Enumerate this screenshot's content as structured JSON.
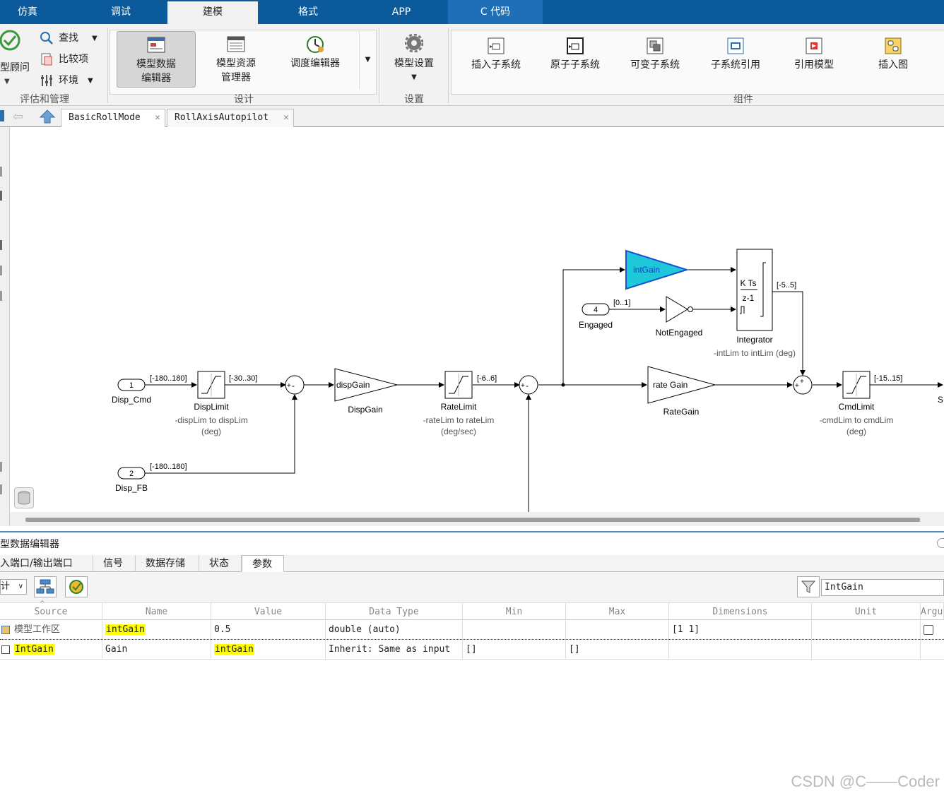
{
  "top_tabs": [
    {
      "label": "仿真"
    },
    {
      "label": "调试"
    },
    {
      "label": "建模"
    },
    {
      "label": "格式"
    },
    {
      "label": "APP"
    },
    {
      "label": "C 代码"
    }
  ],
  "ribbon": {
    "eval_section": {
      "advisor": "型顾问",
      "find": "查找",
      "compare": "比较项",
      "env": "环境",
      "label": "评估和管理"
    },
    "design_section": {
      "mde_line1": "模型数据",
      "mde_line2": "编辑器",
      "res_line1": "模型资源",
      "res_line2": "管理器",
      "schedule": "调度编辑器",
      "label": "设计"
    },
    "setup_section": {
      "model_settings": "模型设置",
      "label": "设置"
    },
    "component_section": {
      "items": [
        {
          "label": "插入子系统"
        },
        {
          "label": "原子子系统"
        },
        {
          "label": "可变子系统"
        },
        {
          "label": "子系统引用"
        },
        {
          "label": "引用模型"
        },
        {
          "label": "插入图"
        }
      ],
      "label": "组件"
    }
  },
  "breadcrumb_tabs": [
    {
      "label": "BasicRollMode"
    },
    {
      "label": "RollAxisAutopilot"
    }
  ],
  "diagram": {
    "inport1_num": "1",
    "inport1_name": "Disp_Cmd",
    "sig1": "[-180..180]",
    "displimit_name": "DispLimit",
    "displimit_sub1": "-dispLim to dispLim",
    "displimit_sub2": "(deg)",
    "sig2": "[-30..30]",
    "sum1_sign1": "+",
    "sum1_sign2": "-",
    "dispgain_param": "dispGain",
    "dispgain_name": "DispGain",
    "ratelimit_name": "RateLimit",
    "ratelimit_sub1": "-rateLim to rateLim",
    "ratelimit_sub2": "(deg/sec)",
    "sig3": "[-6..6]",
    "sum2_sign1": "+",
    "sum2_sign2": "-",
    "inport2_num": "2",
    "inport2_name": "Disp_FB",
    "sig4": "[-180..180]",
    "intgain_param": "intGain",
    "inport4_num": "4",
    "inport4_name": "Engaged",
    "sig5": "[0..1]",
    "not_name": "NotEngaged",
    "integrator_num": "K Ts",
    "integrator_den": "z-1",
    "integrator_name": "Integrator",
    "integrator_sub": "-intLim to intLim (deg)",
    "sig6": "[-5..5]",
    "rategain_param": "rate Gain",
    "rategain_name": "RateGain",
    "sum3_sign1": "+",
    "sum3_sign2": "+",
    "cmdlimit_name": "CmdLimit",
    "cmdlimit_sub1": "-cmdLim to cmdLim",
    "cmdlimit_sub2": "(deg)",
    "sig7": "[-15..15]",
    "out_partial": "S"
  },
  "mde": {
    "title": "型数据编辑器",
    "tabs": [
      {
        "label": "入端口/输出端口"
      },
      {
        "label": "信号"
      },
      {
        "label": "数据存储"
      },
      {
        "label": "状态"
      },
      {
        "label": "参数"
      }
    ],
    "filter_value": "计",
    "search_value": "IntGain",
    "columns": [
      "Source",
      "Name",
      "Value",
      "Data Type",
      "Min",
      "Max",
      "Dimensions",
      "Unit",
      "Argu"
    ],
    "rows": [
      {
        "source": "模型工作区",
        "name": "intGain",
        "value": "0.5",
        "datatype": "double (auto)",
        "min": "",
        "max": "",
        "dimensions": "[1 1]",
        "unit": ""
      },
      {
        "source": "IntGain",
        "name": "Gain",
        "value": "intGain",
        "datatype": "Inherit: Same as input",
        "min": "[]",
        "max": "[]",
        "dimensions": "",
        "unit": ""
      }
    ]
  },
  "watermark": "CSDN @C——Coder",
  "colors": {
    "topbar": "#0a5a9c",
    "highlight": "#ffff00",
    "intgain_fill": "#1ec8d8"
  }
}
